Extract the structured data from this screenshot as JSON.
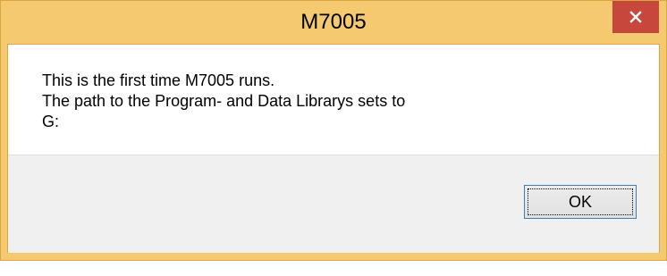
{
  "window": {
    "title": "M7005",
    "close_icon": "close-icon",
    "accent_color": "#f4c970",
    "close_color": "#c7473d"
  },
  "message": {
    "lines": [
      "This is the first time M7005 runs.",
      "The path to the Program- and Data Librarys sets to",
      "G:"
    ]
  },
  "buttons": {
    "ok_label": "OK"
  }
}
